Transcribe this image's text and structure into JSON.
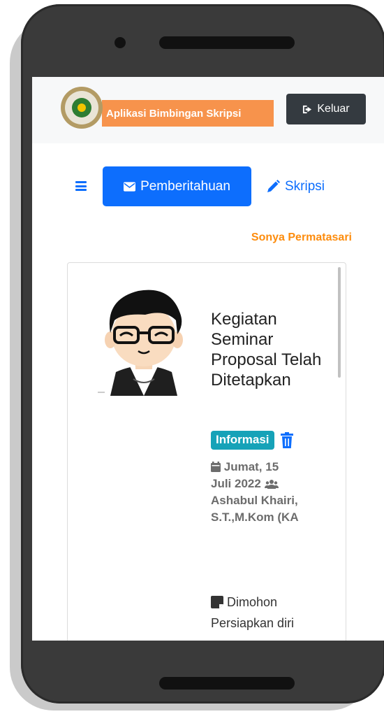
{
  "app": {
    "brand_title": "Aplikasi Bimbingan Skripsi",
    "logout_label": "Keluar"
  },
  "menu": {
    "notification_label": "Pemberitahuan",
    "skripsi_label": "Skripsi"
  },
  "user": {
    "name": "Sonya Permatasari"
  },
  "notification": {
    "title": "Kegiatan Seminar Proposal Telah Ditetapkan",
    "badge": "Informasi",
    "date": "Jumat, 15 Juli 2022",
    "sender": "Ashabul Khairi, S.T.,M.Kom (KA",
    "message": "Dimohon Persiapkan diri"
  },
  "colors": {
    "primary": "#0d6efd",
    "brand_orange": "#f7934c",
    "username_orange": "#fd8c0d",
    "badge_teal": "#16a2b8",
    "dark_button": "#343a40"
  },
  "icons": {
    "logout": "sign-out-icon",
    "menu": "hamburger-icon",
    "notification": "envelope-icon",
    "skripsi": "pencil-icon",
    "delete": "trash-icon",
    "date": "calendar-icon",
    "sender": "users-icon",
    "message": "sticky-note-icon"
  }
}
